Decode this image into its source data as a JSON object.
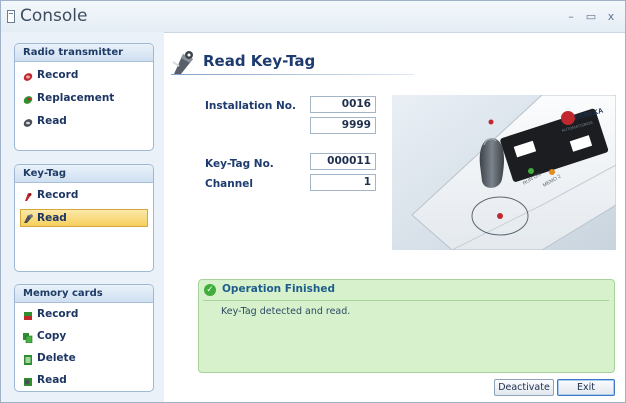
{
  "window": {
    "title": "Console",
    "minimize": "–",
    "maximize": "▭",
    "close": "x"
  },
  "sidebar": {
    "groups": [
      {
        "header": "Radio transmitter",
        "items": [
          {
            "label": "Record",
            "icon": "record-icon",
            "selected": false
          },
          {
            "label": "Replacement",
            "icon": "replacement-icon",
            "selected": false
          },
          {
            "label": "Read",
            "icon": "read-icon",
            "selected": false
          }
        ]
      },
      {
        "header": "Key-Tag",
        "items": [
          {
            "label": "Record",
            "icon": "record-icon",
            "selected": false
          },
          {
            "label": "Read",
            "icon": "read-icon",
            "selected": true
          }
        ]
      },
      {
        "header": "Memory cards",
        "items": [
          {
            "label": "Record",
            "icon": "record-icon",
            "selected": false
          },
          {
            "label": "Copy",
            "icon": "copy-icon",
            "selected": false
          },
          {
            "label": "Delete",
            "icon": "delete-icon",
            "selected": false
          },
          {
            "label": "Read",
            "icon": "read-icon",
            "selected": false
          }
        ]
      }
    ]
  },
  "main": {
    "title": "Read Key-Tag",
    "installation_label": "Installation No.",
    "installation_value_1": "0016",
    "installation_value_2": "9999",
    "keytag_label": "Key-Tag No.",
    "keytag_value": "000011",
    "channel_label": "Channel",
    "channel_value": "1"
  },
  "device": {
    "brand": "ERREKA",
    "subtitle": "AUTOMATISMOS",
    "led_1_label": "RUN ON",
    "led_2_label": "MEMO 2"
  },
  "status": {
    "title": "Operation Finished",
    "message": "Key-Tag detected and read.",
    "accent": "#3fae3a"
  },
  "buttons": {
    "deactivate": "Deactivate",
    "exit": "Exit"
  }
}
